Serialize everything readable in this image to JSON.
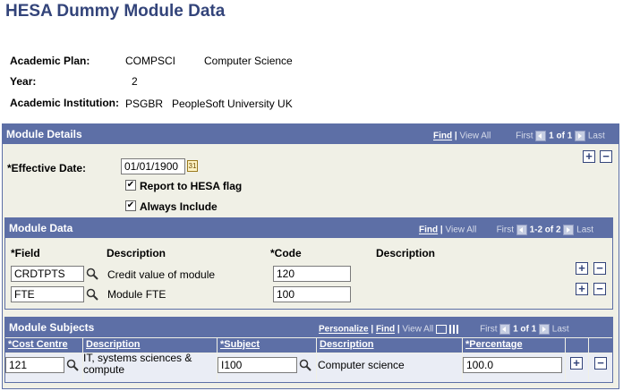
{
  "page": {
    "title": "HESA Dummy Module Data"
  },
  "summary": {
    "plan_label": "Academic Plan:",
    "plan_code": "COMPSCI",
    "plan_desc": "Computer Science",
    "year_label": "Year:",
    "year_value": "2",
    "inst_label": "Academic Institution:",
    "inst_code": "PSGBR",
    "inst_desc": "PeopleSoft University UK"
  },
  "module_details": {
    "title": "Module Details",
    "nav": {
      "find": "Find",
      "sep": "|",
      "view_all": "View All",
      "first": "First",
      "count": "1 of 1",
      "last": "Last"
    },
    "effective_date_label": "*Effective Date:",
    "effective_date": "01/01/1900",
    "report_flag_label": "Report to HESA flag",
    "always_include_label": "Always Include",
    "report_flag_checked": true,
    "always_include_checked": true
  },
  "module_data": {
    "title": "Module Data",
    "nav": {
      "find": "Find",
      "sep": "|",
      "view_all": "View All",
      "first": "First",
      "count": "1-2 of 2",
      "last": "Last"
    },
    "headers": {
      "field": "*Field",
      "description": "Description",
      "code": "*Code",
      "description2": "Description"
    },
    "rows": [
      {
        "field": "CRDTPTS",
        "description": "Credit value of module",
        "code": "120"
      },
      {
        "field": "FTE",
        "description": "Module FTE",
        "code": "100"
      }
    ]
  },
  "module_subjects": {
    "title": "Module Subjects",
    "nav": {
      "personalize": "Personalize",
      "find": "Find",
      "view_all": "View All",
      "first": "First",
      "count": "1 of 1",
      "last": "Last"
    },
    "headers": {
      "cost_centre": "*Cost Centre",
      "description": "Description",
      "subject": "*Subject",
      "description2": "Description",
      "percentage": "*Percentage"
    },
    "rows": [
      {
        "cost_centre": "121",
        "cc_description": "IT, systems sciences & compute",
        "subject": "I100",
        "subject_description": "Computer science",
        "percentage": "100.0"
      }
    ]
  },
  "colors": {
    "header_bg": "#5d6fa6",
    "panel_bg": "#f0f0e6",
    "title": "#33447a"
  }
}
